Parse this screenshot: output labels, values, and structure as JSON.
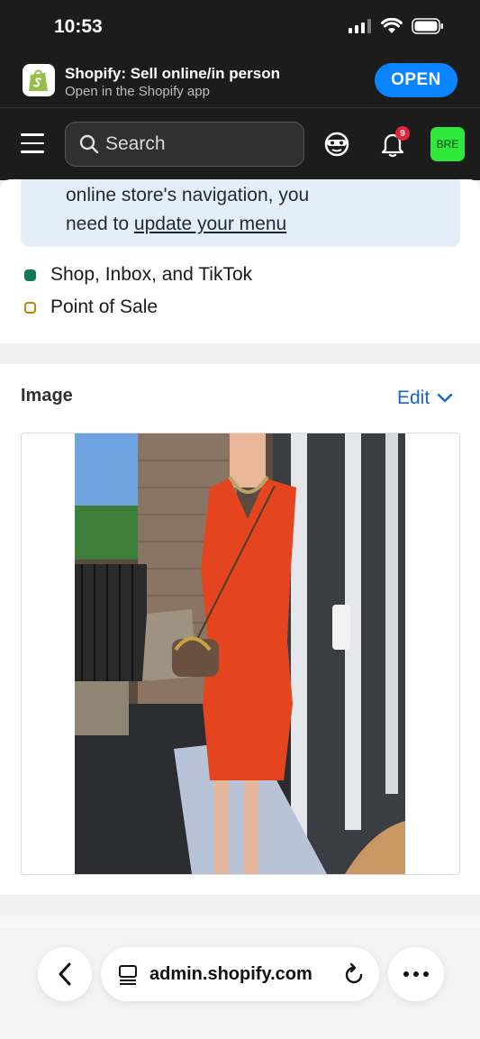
{
  "status_bar": {
    "time": "10:53"
  },
  "app_banner": {
    "title": "Shopify: Sell online/in person",
    "subtitle": "Open in the Shopify app",
    "open_label": "OPEN"
  },
  "nav": {
    "search_placeholder": "Search",
    "notification_count": "9",
    "avatar_initials": "BRE"
  },
  "notice": {
    "line1": "online store's navigation, you",
    "line2_prefix": "need to ",
    "link_text": "update your menu"
  },
  "channels": [
    {
      "label": "Shop, Inbox, and TikTok",
      "status": "active",
      "color": "#0f7a5a"
    },
    {
      "label": "Point of Sale",
      "status": "inactive",
      "color": "#b98900"
    }
  ],
  "image_section": {
    "heading": "Image",
    "edit_label": "Edit"
  },
  "browser": {
    "url": "admin.shopify.com"
  },
  "colors": {
    "accent": "#0a84ff",
    "link_blue": "#1a63d2",
    "avatar_bg": "#2ee83a",
    "badge": "#e5243a"
  }
}
